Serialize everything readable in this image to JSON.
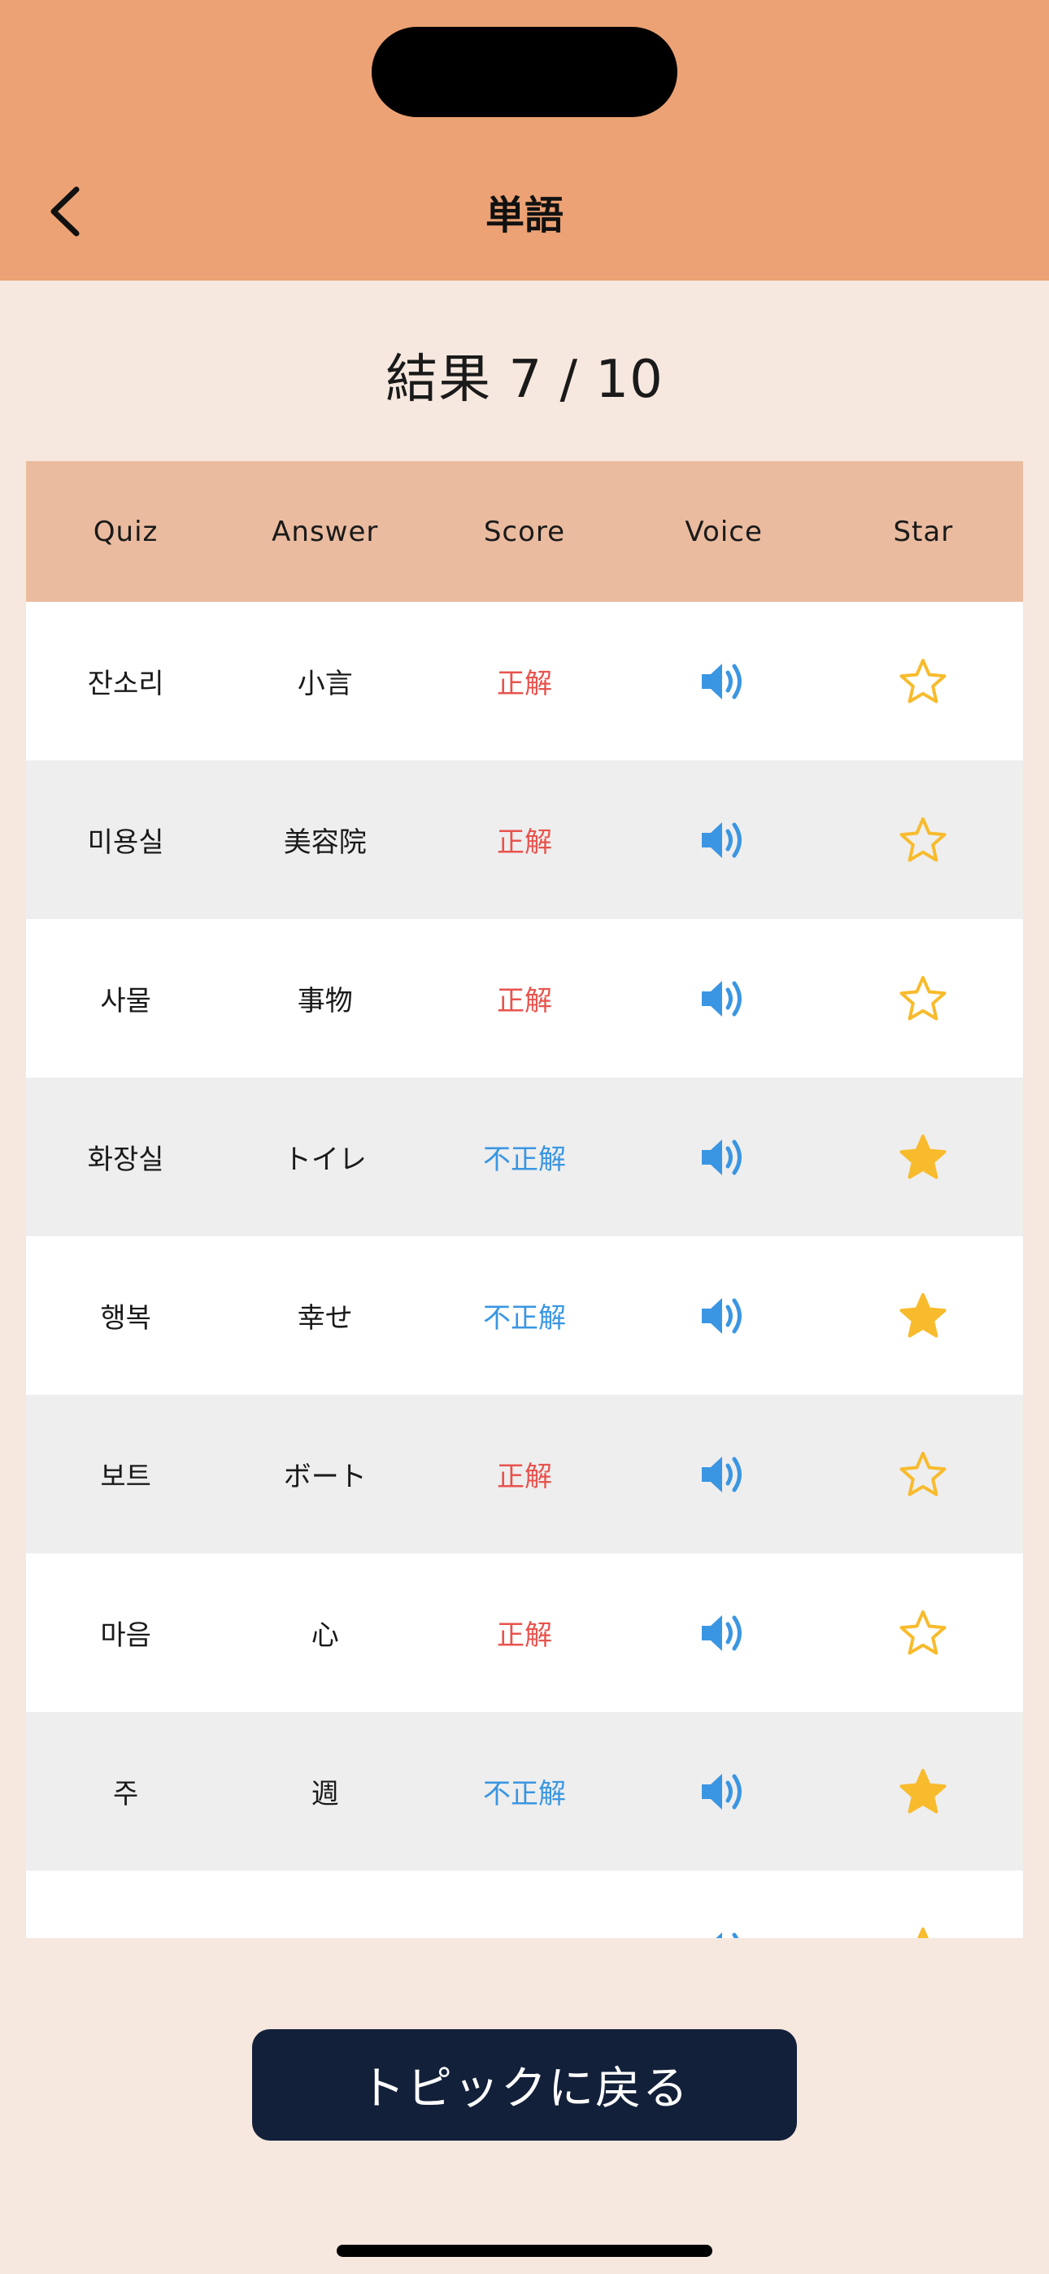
{
  "header": {
    "title": "単語"
  },
  "result": {
    "title": "結果 7 / 10"
  },
  "table": {
    "columns": [
      "Quiz",
      "Answer",
      "Score",
      "Voice",
      "Star"
    ],
    "rows": [
      {
        "quiz": "잔소리",
        "answer": "小言",
        "score": "正解",
        "correct": true,
        "starred": false
      },
      {
        "quiz": "미용실",
        "answer": "美容院",
        "score": "正解",
        "correct": true,
        "starred": false
      },
      {
        "quiz": "사물",
        "answer": "事物",
        "score": "正解",
        "correct": true,
        "starred": false
      },
      {
        "quiz": "화장실",
        "answer": "トイレ",
        "score": "不正解",
        "correct": false,
        "starred": true
      },
      {
        "quiz": "행복",
        "answer": "幸せ",
        "score": "不正解",
        "correct": false,
        "starred": true
      },
      {
        "quiz": "보트",
        "answer": "ボート",
        "score": "正解",
        "correct": true,
        "starred": false
      },
      {
        "quiz": "마음",
        "answer": "心",
        "score": "正解",
        "correct": true,
        "starred": false
      },
      {
        "quiz": "주",
        "answer": "週",
        "score": "不正解",
        "correct": false,
        "starred": true
      },
      {
        "quiz": "",
        "answer": "",
        "score": "",
        "correct": true,
        "starred": true
      }
    ]
  },
  "footer": {
    "button_label": "トピックに戻る"
  },
  "colors": {
    "header_bg": "#eca274",
    "table_header_bg": "#eabb9f",
    "correct": "#e8534d",
    "wrong": "#3a96e2",
    "star": "#f8bb2d",
    "button_bg": "#13203a"
  },
  "icons": {
    "back": "chevron-left-icon",
    "voice": "speaker-icon",
    "star_empty": "star-outline-icon",
    "star_filled": "star-filled-icon"
  }
}
